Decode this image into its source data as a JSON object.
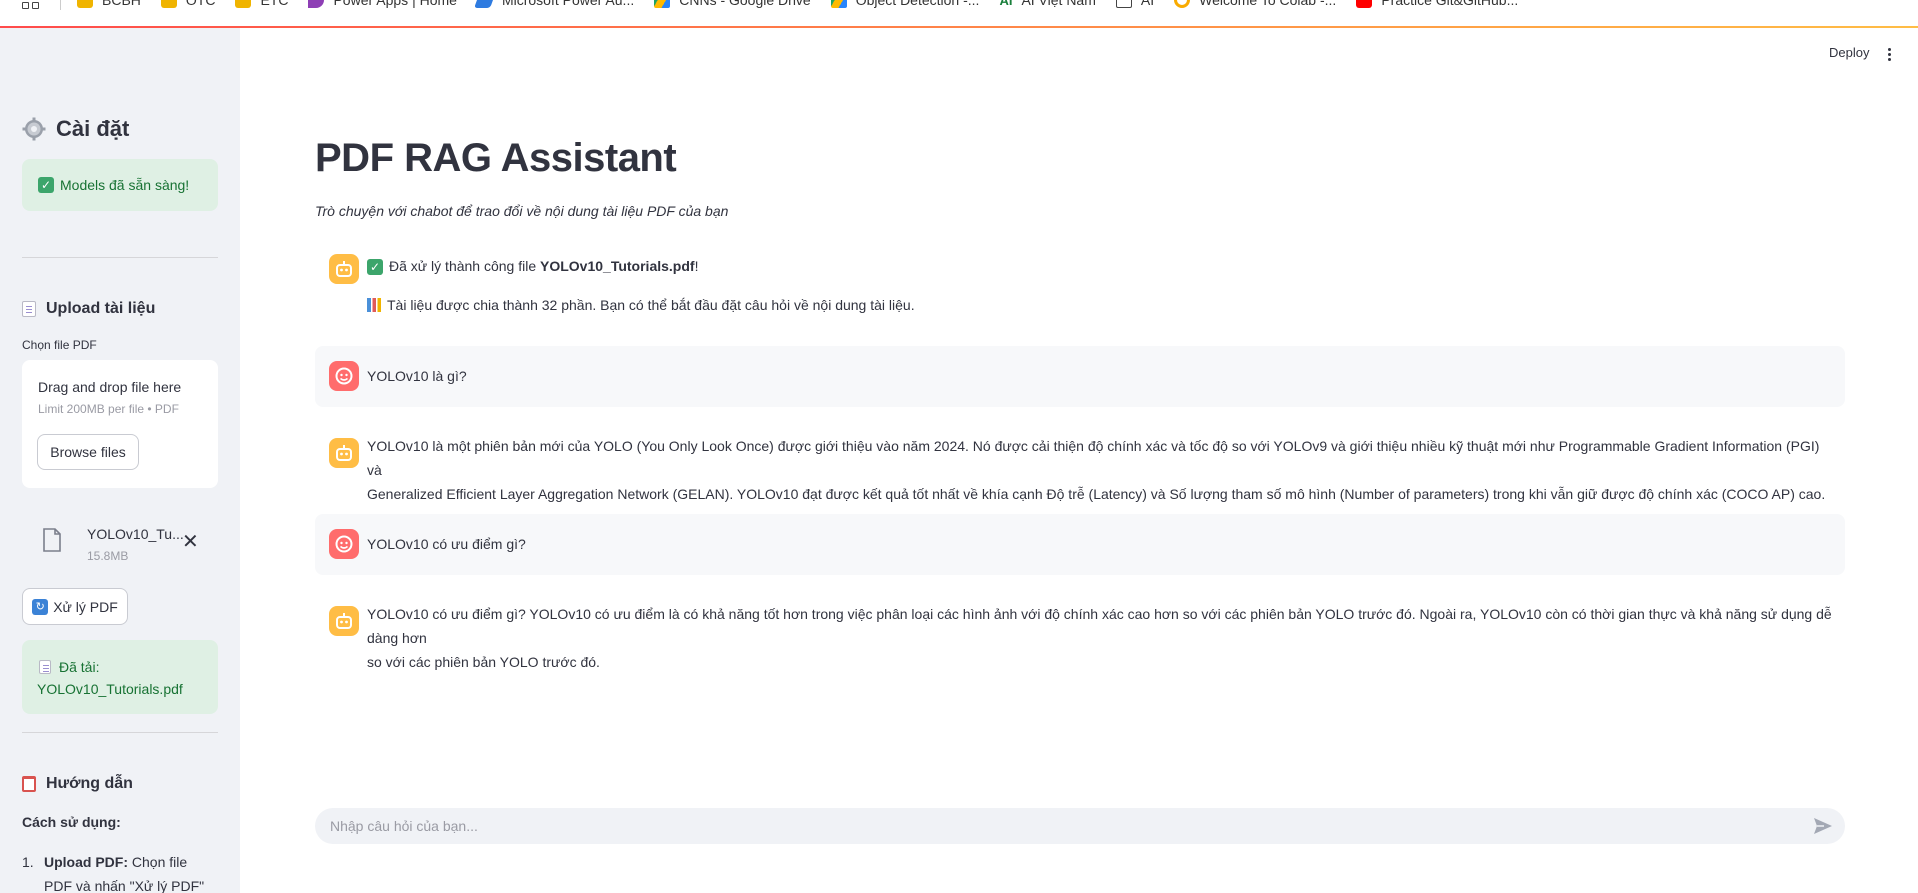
{
  "bookmarks": [
    {
      "label": "BCBH",
      "icon": "folder-icon"
    },
    {
      "label": "OTC",
      "icon": "folder-icon"
    },
    {
      "label": "ETC",
      "icon": "folder-icon"
    },
    {
      "label": "Power Apps | Home",
      "icon": "power-apps-icon"
    },
    {
      "label": "Microsoft Power Au...",
      "icon": "power-automate-icon"
    },
    {
      "label": "CNNs - Google Drive",
      "icon": "google-drive-icon"
    },
    {
      "label": "Object Detection -...",
      "icon": "google-drive-icon"
    },
    {
      "label": "AI Việt Nam",
      "icon": "ai-vietnam-icon"
    },
    {
      "label": "AI",
      "icon": "page-icon"
    },
    {
      "label": "Welcome To Colab -...",
      "icon": "colab-icon"
    },
    {
      "label": "Practice Git&GitHub...",
      "icon": "youtube-icon"
    }
  ],
  "header": {
    "deploy_label": "Deploy"
  },
  "sidebar": {
    "title": "Cài đặt",
    "models_status": "Models đã sẵn sàng!",
    "upload_heading": "Upload tài liệu",
    "file_label": "Chọn file PDF",
    "dropzone_title": "Drag and drop file here",
    "dropzone_limit": "Limit 200MB per file • PDF",
    "browse_label": "Browse files",
    "uploaded_file": {
      "name": "YOLOv10_Tu...",
      "size": "15.8MB"
    },
    "process_label": "Xử lý PDF",
    "loaded_prefix": "Đã tải:",
    "loaded_file": "YOLOv10_Tutorials.pdf",
    "guide_heading": "Hướng dẫn",
    "usage_heading": "Cách sử dụng:",
    "steps": [
      {
        "num": "1.",
        "bold": "Upload PDF:",
        "text": "Chọn file PDF và nhấn \"Xử lý PDF\""
      }
    ]
  },
  "main": {
    "title": "PDF RAG Assistant",
    "subtitle": "Trò chuyện với chabot để trao đổi về nội dung tài liệu PDF của bạn",
    "messages": [
      {
        "role": "assistant",
        "line1_prefix": "Đã xử lý thành công file ",
        "line1_file": "YOLOv10_Tutorials.pdf",
        "line1_suffix": "!",
        "line2": "Tài liệu được chia thành 32 phần. Bạn có thể bắt đầu đặt câu hỏi về nội dung tài liệu."
      },
      {
        "role": "user",
        "text": "YOLOv10 là gì?"
      },
      {
        "role": "assistant",
        "line1": "YOLOv10 là một phiên bản mới của YOLO (You Only Look Once) được giới thiệu vào năm 2024. Nó được cải thiện độ chính xác và tốc độ so với YOLOv9 và giới thiệu nhiều kỹ thuật mới như Programmable Gradient Information (PGI) và",
        "line2": "Generalized Efficient Layer Aggregation Network (GELAN). YOLOv10 đạt được kết quả tốt nhất về khía cạnh Độ trễ (Latency) và Số lượng tham số mô hình (Number of parameters) trong khi vẫn giữ được độ chính xác (COCO AP) cao."
      },
      {
        "role": "user",
        "text": "YOLOv10 có ưu điểm gì?"
      },
      {
        "role": "assistant",
        "line1": "YOLOv10 có ưu điểm gì? YOLOv10 có ưu điểm là có khả năng tốt hơn trong việc phân loại các hình ảnh với độ chính xác cao hơn so với các phiên bản YOLO trước đó. Ngoài ra, YOLOv10 còn có thời gian thực và khả năng sử dụng dễ dàng hơn",
        "line2": "so với các phiên bản YOLO trước đó."
      }
    ],
    "chat_placeholder": "Nhập câu hỏi của bạn..."
  },
  "colors": {
    "sidebar_bg": "#f0f2f6",
    "success_bg": "#dff0e4",
    "success_text": "#177233",
    "assistant_avatar": "#ffbd45",
    "user_avatar": "#ff6c6c",
    "user_message_bg": "#f7f8fa",
    "text": "#31333f"
  }
}
